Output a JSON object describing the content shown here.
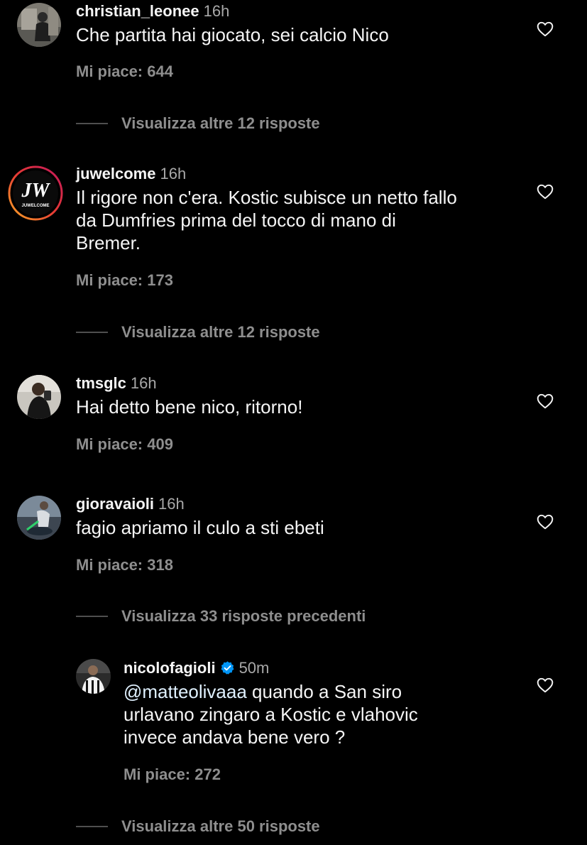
{
  "accent": "#0095f6",
  "comments": [
    {
      "username": "christian_leonee",
      "time": "16h",
      "text": "Che partita hai giocato, sei calcio Nico",
      "likes": "Mi piace: 644",
      "avatar": "photo-avatar"
    },
    {
      "username": "juwelcome",
      "time": "16h",
      "text": "Il rigore non c'era. Kostic subisce un netto fallo\nda Dumfries prima del tocco di mano di\nBremer.",
      "likes": "Mi piace: 173",
      "avatar": "juwelcome-logo",
      "logo_text": "JUWELCOME"
    },
    {
      "username": "tmsglc",
      "time": "16h",
      "text": "Hai detto bene nico, ritorno!",
      "likes": "Mi piace: 409",
      "avatar": "photo-avatar"
    },
    {
      "username": "gioravaioli",
      "time": "16h",
      "text": "fagio apriamo il culo a sti ebeti",
      "likes": "Mi piace: 318",
      "avatar": "photo-avatar"
    }
  ],
  "reply": {
    "username": "nicolofagioli",
    "verified": true,
    "time": "50m",
    "mention": "@matteolivaaa",
    "text": " quando a San siro\nurlavano zingaro a Kostic e vlahovic\ninvece andava bene vero ?",
    "likes": "Mi piace: 272",
    "avatar": "photo-avatar"
  },
  "view_replies": {
    "c1": "Visualizza altre 12 risposte",
    "c2": "Visualizza altre 12 risposte",
    "c4_previous": "Visualizza 33 risposte precedenti",
    "reply_more": "Visualizza altre 50 risposte"
  }
}
